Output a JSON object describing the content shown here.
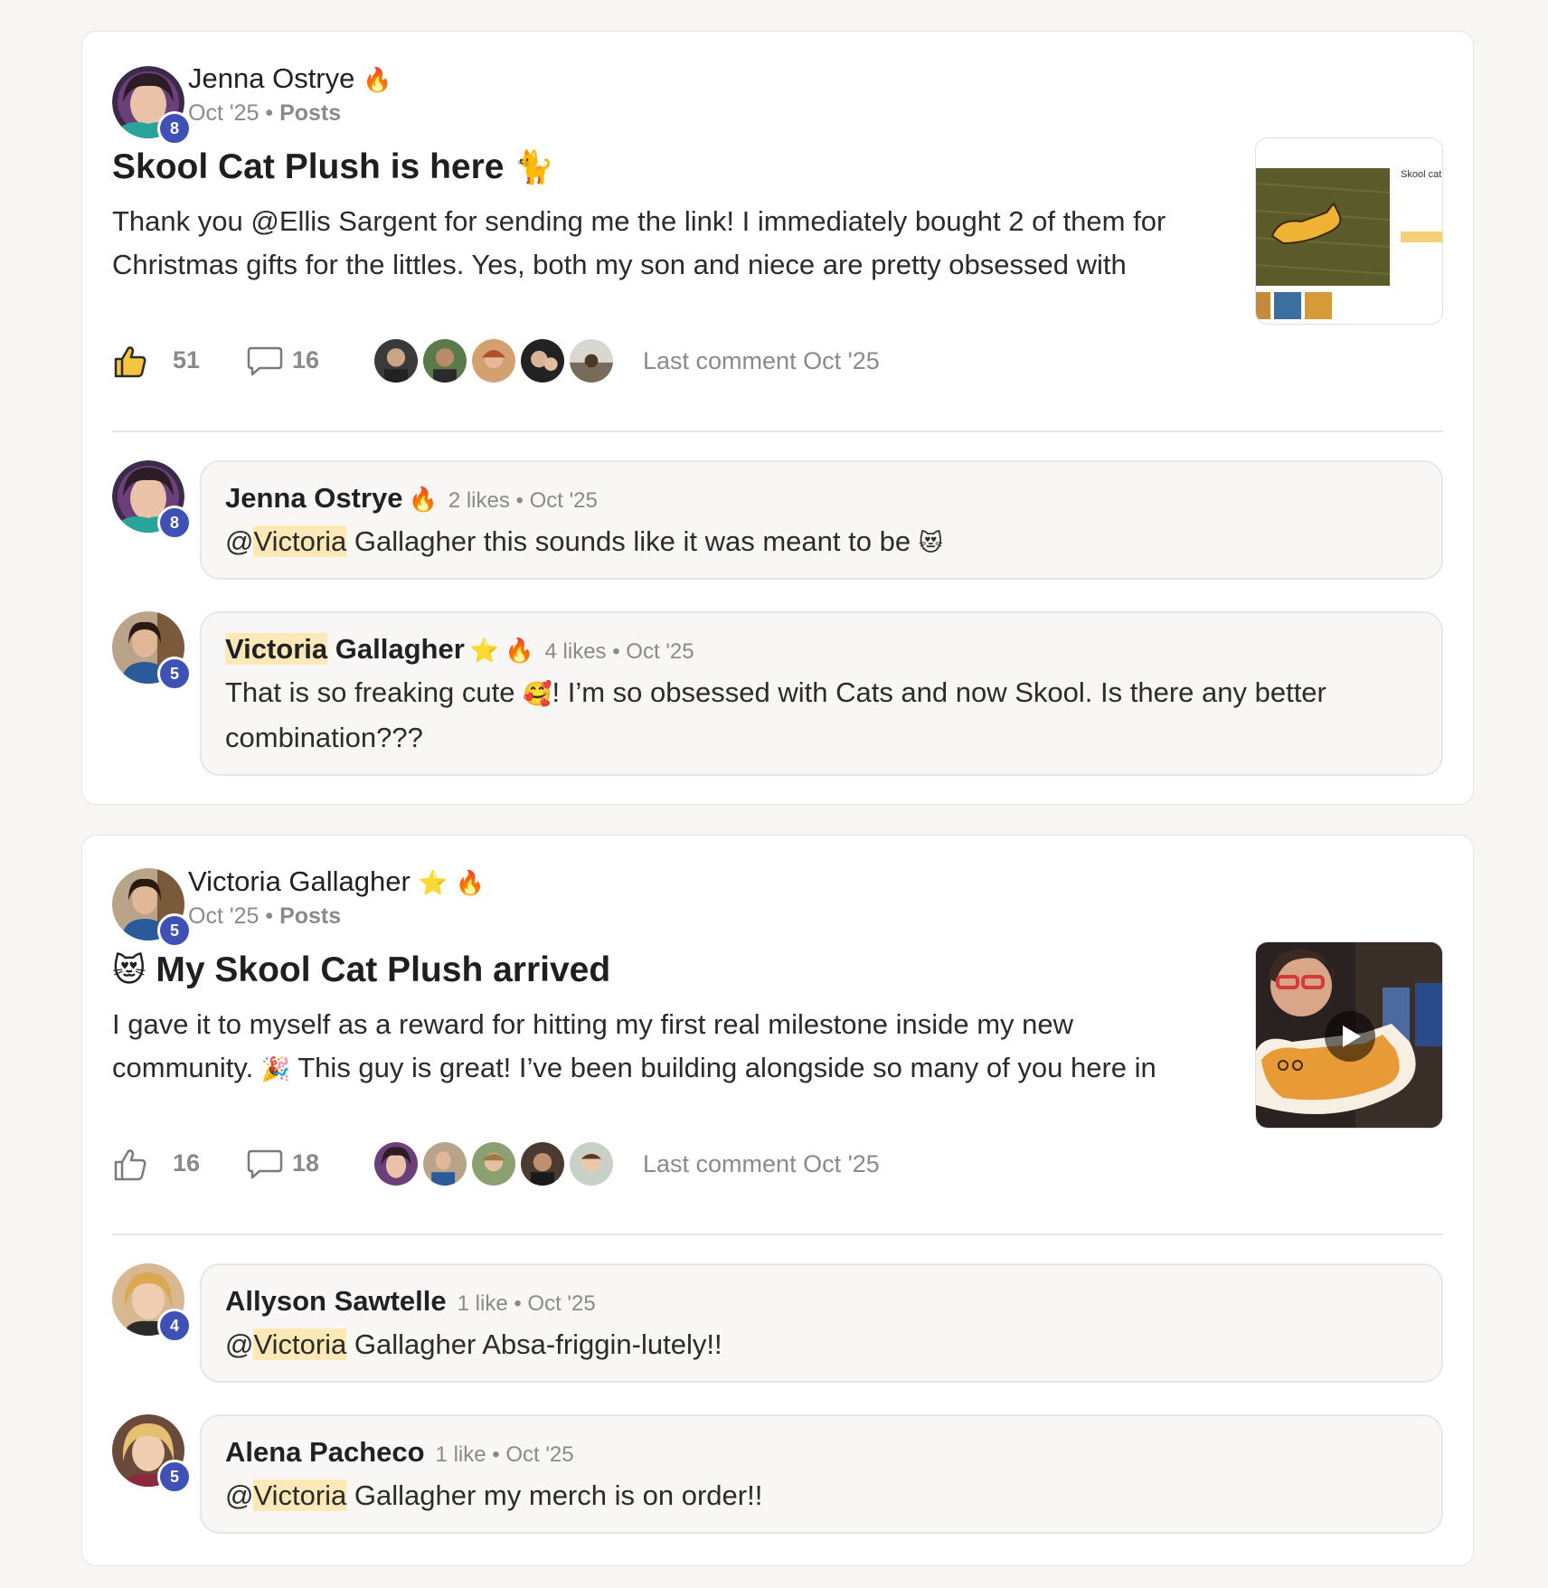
{
  "posts": [
    {
      "author": "Jenna Ostrye",
      "author_level": "8",
      "date": "Oct '25",
      "category": "Posts",
      "title": "Skool Cat Plush is here",
      "body_line1": "Thank you @Ellis Sargent for sending me the link! I immediately bought 2 of them for",
      "body_line2": "Christmas gifts for the littles. Yes, both my son and niece are pretty obsessed with",
      "likes": "51",
      "comments": "16",
      "last_comment": "Last comment Oct '25",
      "thumbnail_caption": "Skool cat",
      "comments_list": [
        {
          "name": "Jenna Ostrye",
          "level": "8",
          "meta": "2 likes • Oct '25",
          "mention": "Victoria",
          "text": " Gallagher this sounds like it was meant to be"
        },
        {
          "name_hl": "Victoria",
          "name_rest": " Gallagher",
          "level": "5",
          "meta": "4 likes • Oct '25",
          "text_a": "That is so freaking cute",
          "text_b": "! I’m so obsessed with Cats and now Skool. Is there any better",
          "text_c": "combination???"
        }
      ]
    },
    {
      "author": "Victoria Gallagher",
      "author_level": "5",
      "date": "Oct '25",
      "category": "Posts",
      "title": "My Skool Cat Plush arrived",
      "body_line1": "I gave it to myself as a reward for hitting my first real milestone inside my new",
      "body_line2a": "community.",
      "body_line2b": "This guy is great! I’ve been building alongside so many of you here in",
      "likes": "16",
      "comments": "18",
      "last_comment": "Last comment Oct '25",
      "comments_list": [
        {
          "name": "Allyson Sawtelle",
          "level": "4",
          "meta": "1 like • Oct '25",
          "mention": "Victoria",
          "text": " Gallagher Absa-friggin-lutely!!"
        },
        {
          "name": "Alena Pacheco",
          "level": "5",
          "meta": "1 like • Oct '25",
          "mention": "Victoria",
          "text": " Gallagher my merch is on order!!"
        }
      ]
    }
  ],
  "icons": {
    "like": "thumbs-up-icon",
    "comment": "speech-bubble-icon",
    "fire": "fire-icon",
    "star": "star-icon",
    "cat": "cat-emoji",
    "play": "play-icon"
  },
  "colors": {
    "badge": "#3f51b5",
    "mention_highlight": "#fde8b7",
    "muted": "#8a8a8a"
  }
}
